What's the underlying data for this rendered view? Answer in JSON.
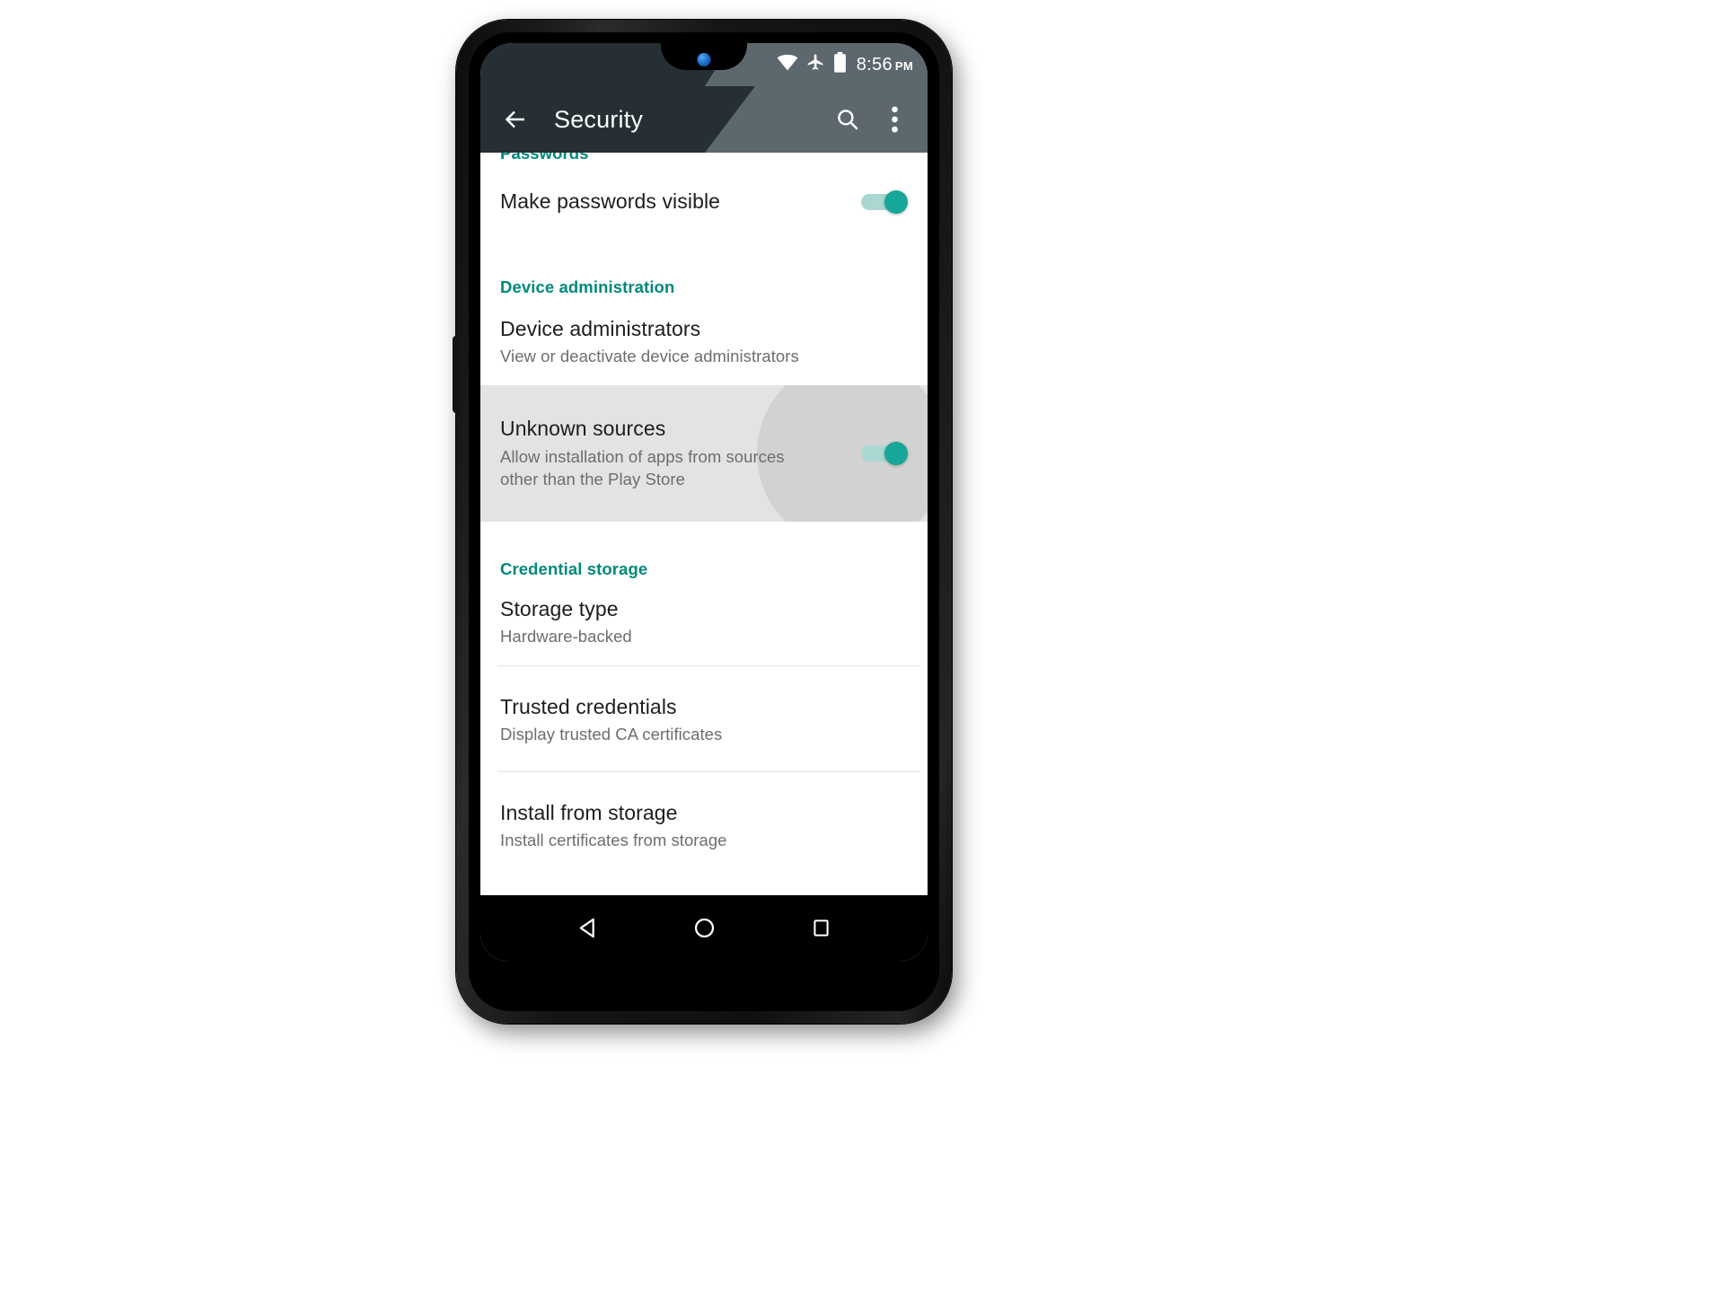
{
  "status_bar": {
    "wifi_icon": "wifi-icon",
    "airplane_icon": "airplane-mode-icon",
    "battery_icon": "battery-icon",
    "time": "8:56",
    "ampm": "PM"
  },
  "action_bar": {
    "back_icon": "back-arrow-icon",
    "title": "Security",
    "search_icon": "search-icon",
    "overflow_icon": "overflow-menu-icon"
  },
  "sections": [
    {
      "header": "Passwords",
      "rows": [
        {
          "title": "Make passwords visible",
          "subtitle": "",
          "control": "switch",
          "switch_on": true
        }
      ]
    },
    {
      "header": "Device administration",
      "rows": [
        {
          "title": "Device administrators",
          "subtitle": "View or deactivate device administrators",
          "control": "none"
        },
        {
          "title": "Unknown sources",
          "subtitle": "Allow installation of apps from sources other than the Play Store",
          "control": "switch",
          "switch_on": true,
          "highlighted": true
        }
      ]
    },
    {
      "header": "Credential storage",
      "rows": [
        {
          "title": "Storage type",
          "subtitle": "Hardware-backed",
          "control": "none"
        },
        {
          "title": "Trusted credentials",
          "subtitle": "Display trusted CA certificates",
          "control": "none"
        },
        {
          "title": "Install from storage",
          "subtitle": "Install certificates from storage",
          "control": "none"
        }
      ]
    }
  ],
  "rows_flat": {
    "make_passwords_visible": {
      "title": "Make passwords visible"
    },
    "device_administrators": {
      "title": "Device administrators",
      "subtitle": "View or deactivate device administrators"
    },
    "unknown_sources": {
      "title": "Unknown sources",
      "subtitle_line1": "Allow installation of apps from sources",
      "subtitle_line2": "other than the Play Store"
    },
    "storage_type": {
      "title": "Storage type",
      "subtitle": "Hardware-backed"
    },
    "trusted_credentials": {
      "title": "Trusted credentials",
      "subtitle": "Display trusted CA certificates"
    },
    "install_from_storage": {
      "title": "Install from storage",
      "subtitle": "Install certificates from storage"
    }
  },
  "headers": {
    "passwords": "Passwords",
    "device_administration": "Device administration",
    "credential_storage": "Credential storage"
  },
  "nav_bar": {
    "back": "nav-back-icon",
    "home": "nav-home-icon",
    "recents": "nav-recents-icon"
  },
  "colors": {
    "accent_teal": "#00897b",
    "switch_thumb": "#16a79a",
    "switch_track": "#a9d7d2",
    "action_bar_dark": "#252f34",
    "action_bar_light": "#5d686e",
    "row_highlight": "#e3e3e3",
    "ripple": "#d2d2d2",
    "title_text": "#1d1d1d",
    "subtitle_text": "#6d6d6d",
    "nav_bar": "#000000"
  }
}
